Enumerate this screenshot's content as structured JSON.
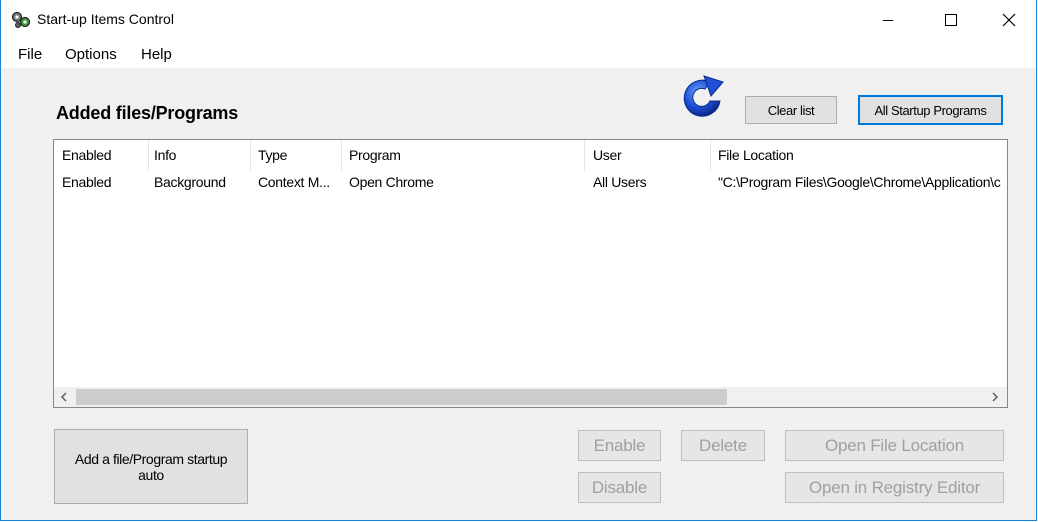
{
  "window": {
    "title": "Start-up Items Control",
    "controls": {
      "minimize": "—",
      "maximize": "☐",
      "close": "✕"
    }
  },
  "menu": [
    "File",
    "Options",
    "Help"
  ],
  "section_title": "Added files/Programs",
  "toolbar": {
    "refresh_icon": "refresh-icon",
    "clear_list": "Clear list",
    "all_startup": "All Startup Programs"
  },
  "list": {
    "columns": [
      "Enabled",
      "Info",
      "Type",
      "Program",
      "User",
      "File Location"
    ],
    "rows": [
      [
        "Enabled",
        "Background",
        "Context M...",
        "Open Chrome",
        "All Users",
        "\"C:\\Program Files\\Google\\Chrome\\Application\\c"
      ]
    ]
  },
  "scrollbar": {
    "left": "‹",
    "right": "›"
  },
  "actions": {
    "add": "Add a file/Program startup auto",
    "enable": "Enable",
    "delete": "Delete",
    "open_location": "Open File Location",
    "disable": "Disable",
    "open_registry": "Open in Registry Editor"
  },
  "colors": {
    "accent": "#0078d7",
    "refresh_blue": "#1f4fd8",
    "disabled_text": "#a0a0a0"
  }
}
